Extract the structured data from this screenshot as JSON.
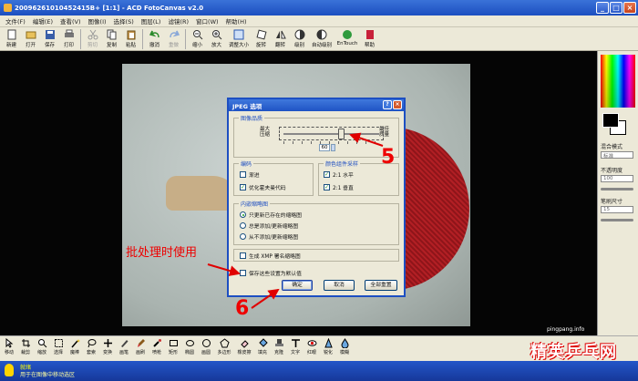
{
  "window": {
    "title": "20096261010452415B+ [1:1] - ACD FotoCanvas v2.0",
    "buttons": [
      "_",
      "□",
      "×"
    ]
  },
  "menu": [
    "文件(F)",
    "编辑(E)",
    "查看(V)",
    "图像(I)",
    "选择(S)",
    "图层(L)",
    "滤镜(R)",
    "窗口(W)",
    "帮助(H)"
  ],
  "toolbar": [
    "新建",
    "打开",
    "保存",
    "打印",
    "剪切",
    "复制",
    "粘贴",
    "撤消",
    "重做",
    "缩小",
    "放大",
    "调整大小",
    "旋转",
    "翻转",
    "级别",
    "自动级别",
    "EnTouch",
    "帮助"
  ],
  "dialog": {
    "title": "JPEG 选项",
    "image_quality": {
      "label": "图像品质",
      "max_label": "最大\n压缩",
      "best_label": "最佳\n质量",
      "value": "60",
      "slider_position": 0.58
    },
    "encoding": {
      "label": "编码",
      "options": [
        {
          "label": "渐进",
          "checked": false
        },
        {
          "label": "优化霍夫曼代码",
          "checked": true
        }
      ]
    },
    "chroma": {
      "label": "颜色组件采样",
      "options": [
        {
          "label": "2:1 水平",
          "checked": true
        },
        {
          "label": "2:1 垂直",
          "checked": true
        }
      ]
    },
    "embedded": {
      "label": "内嵌缩略图",
      "options": [
        {
          "label": "只更新已存在的缩略图",
          "selected": true
        },
        {
          "label": "总是添加/更新缩略图",
          "selected": false
        },
        {
          "label": "从不添加/更新缩略图",
          "selected": false
        }
      ]
    },
    "generate_xmp": {
      "label": "生成 XMP 署名缩略图",
      "checked": false
    },
    "save_default": {
      "label": "保存这些设置为默认值",
      "checked": false
    },
    "buttons": {
      "ok": "确定",
      "cancel": "取消",
      "reset": "全部重置"
    }
  },
  "annotations": {
    "batch_note": "批处理时使用",
    "step5": "5",
    "step6": "6",
    "color": "#e00000"
  },
  "right_panel": {
    "blend_label": "混合模式",
    "blend_value": "标准",
    "opacity_label": "不透明度",
    "opacity_value": "100",
    "size_label": "笔刷尺寸",
    "size_value": "15"
  },
  "bottom_toolbar": [
    "移动",
    "裁剪",
    "缩放",
    "选择",
    "魔棒",
    "套索",
    "变换",
    "画笔",
    "画刷",
    "喷枪",
    "矩形",
    "椭圆",
    "画圆",
    "多边形",
    "橡皮擦",
    "填充",
    "克隆",
    "文字",
    "红眼",
    "锐化",
    "模糊"
  ],
  "status": {
    "line1": "就绪",
    "line2": "用于在图像中移动选区"
  },
  "watermark": {
    "site": "pingpang.info",
    "brand": "精英乒乓网"
  }
}
